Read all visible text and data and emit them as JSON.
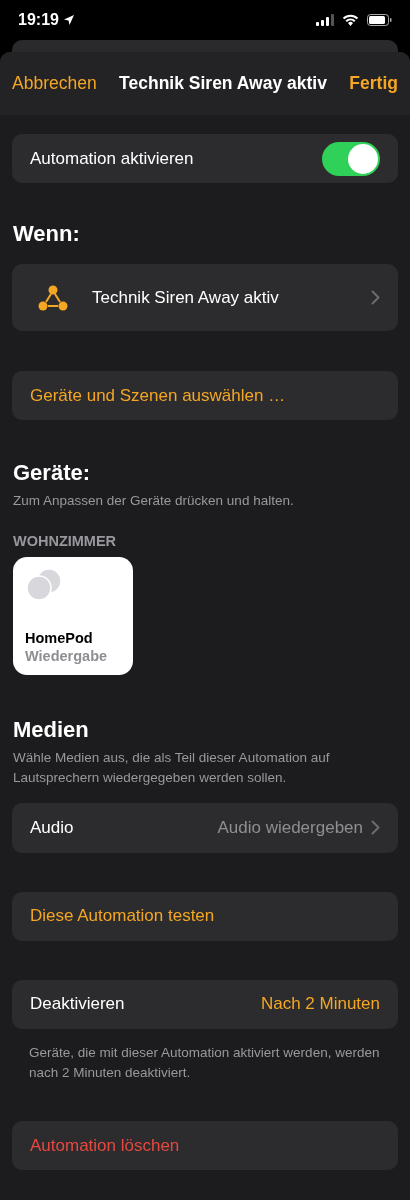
{
  "status_bar": {
    "time": "19:19"
  },
  "header": {
    "cancel": "Abbrechen",
    "title": "Technik Siren Away aktiv",
    "done": "Fertig"
  },
  "enable": {
    "label": "Automation aktivieren",
    "on": true
  },
  "trigger": {
    "heading": "Wenn:",
    "label": "Technik Siren Away aktiv"
  },
  "select_button": "Geräte und Szenen auswählen …",
  "devices": {
    "heading": "Geräte:",
    "hint": "Zum Anpassen der Geräte drücken und halten.",
    "room": "WOHNZIMMER",
    "tiles": [
      {
        "name": "HomePod",
        "status": "Wiedergabe"
      }
    ]
  },
  "media": {
    "heading": "Medien",
    "description": "Wähle Medien aus, die als Teil dieser Automation auf Lautsprechern wiedergegeben werden sollen.",
    "row": {
      "label": "Audio",
      "value": "Audio wiedergeben"
    }
  },
  "test_button": "Diese Automation testen",
  "deactivate": {
    "label": "Deaktivieren",
    "value": "Nach 2 Minuten",
    "footnote": "Geräte, die mit dieser Automation aktiviert werden, werden nach 2 Minuten deaktiviert."
  },
  "delete_button": "Automation löschen"
}
